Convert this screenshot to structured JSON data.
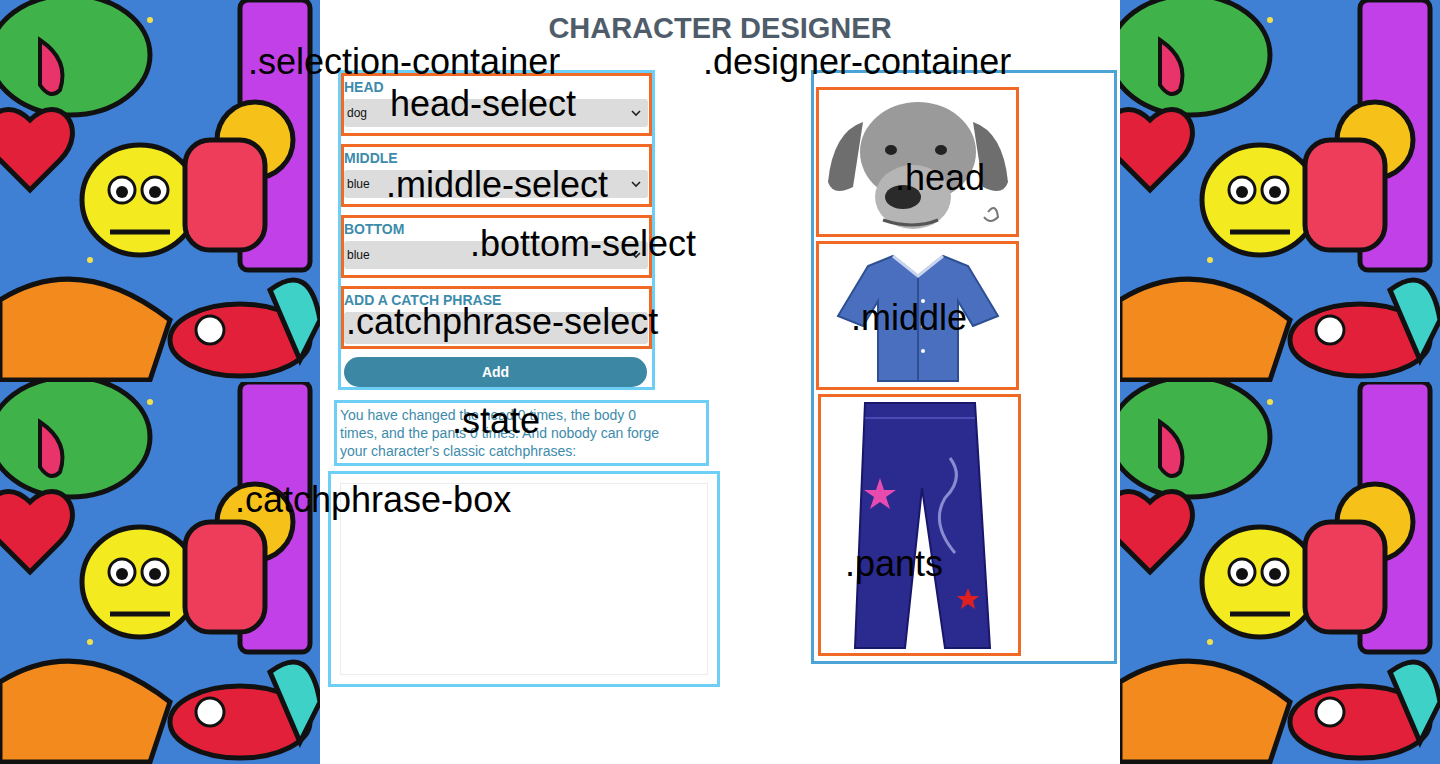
{
  "page": {
    "title": "CHARACTER DESIGNER"
  },
  "annotations": {
    "selection_container": ".selection-container",
    "designer_container": ".designer-container",
    "head_select": "head-select",
    "middle_select": ".middle-select",
    "bottom_select": ".bottom-select",
    "catchphrase_select": ".catchphrase-select",
    "state": ".state",
    "catchphrase_box": ".catchphrase-box",
    "head": ".head",
    "middle": ".middle",
    "pants": ".pants"
  },
  "form": {
    "head": {
      "label": "HEAD",
      "value": "dog"
    },
    "middle": {
      "label": "MIDDLE",
      "value": "blue"
    },
    "bottom": {
      "label": "BOTTOM",
      "value": "blue"
    },
    "catchphrase": {
      "label": "ADD A CATCH PHRASE",
      "value": ""
    },
    "button": "Add"
  },
  "state": {
    "lines": [
      "You have changed the head 0 times, the body 0",
      "times, and the pants 0 times. And nobody can forge",
      "your character's classic catchphrases:"
    ]
  }
}
